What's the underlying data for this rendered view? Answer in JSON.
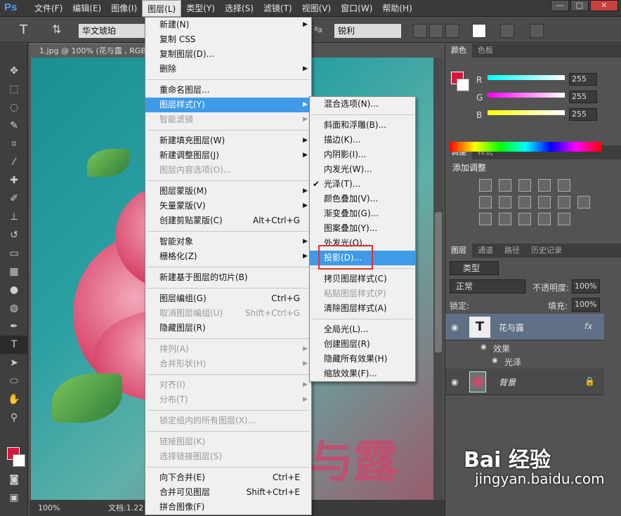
{
  "app": {
    "logo": "Ps",
    "logo_color": "#4ea0ff"
  },
  "menubar": [
    "文件(F)",
    "编辑(E)",
    "图像(I)",
    "图层(L)",
    "类型(Y)",
    "选择(S)",
    "滤镜(T)",
    "视图(V)",
    "窗口(W)",
    "帮助(H)"
  ],
  "options": {
    "font_family": "华文琥珀",
    "antialias": "锐利",
    "aa_icon": "ªa"
  },
  "document": {
    "tab_title": "1.jpg @ 100% (花与露 , RGB",
    "zoom": "100%",
    "doc_label": "文档:1.22"
  },
  "canvas_text": "与露",
  "layer_menu": [
    {
      "label": "新建(N)",
      "sub": true
    },
    {
      "label": "复制 CSS"
    },
    {
      "label": "复制图层(D)..."
    },
    {
      "label": "删除",
      "sub": true
    },
    {
      "sep": true
    },
    {
      "label": "重命名图层..."
    },
    {
      "label": "图层样式(Y)",
      "sub": true,
      "hi": true
    },
    {
      "label": "智能滤镜",
      "sub": true,
      "dis": true
    },
    {
      "sep": true
    },
    {
      "label": "新建填充图层(W)",
      "sub": true
    },
    {
      "label": "新建调整图层(J)",
      "sub": true
    },
    {
      "label": "图层内容选项(O)...",
      "dis": true
    },
    {
      "sep": true
    },
    {
      "label": "图层蒙版(M)",
      "sub": true
    },
    {
      "label": "矢量蒙版(V)",
      "sub": true
    },
    {
      "label": "创建剪贴蒙版(C)",
      "shortcut": "Alt+Ctrl+G"
    },
    {
      "sep": true
    },
    {
      "label": "智能对象",
      "sub": true
    },
    {
      "label": "栅格化(Z)",
      "sub": true
    },
    {
      "sep": true
    },
    {
      "label": "新建基于图层的切片(B)"
    },
    {
      "sep": true
    },
    {
      "label": "图层编组(G)",
      "shortcut": "Ctrl+G"
    },
    {
      "label": "取消图层编组(U)",
      "shortcut": "Shift+Ctrl+G",
      "dis": true
    },
    {
      "label": "隐藏图层(R)"
    },
    {
      "sep": true
    },
    {
      "label": "排列(A)",
      "sub": true,
      "dis": true
    },
    {
      "label": "合并形状(H)",
      "sub": true,
      "dis": true
    },
    {
      "sep": true
    },
    {
      "label": "对齐(I)",
      "sub": true,
      "dis": true
    },
    {
      "label": "分布(T)",
      "sub": true,
      "dis": true
    },
    {
      "sep": true
    },
    {
      "label": "锁定组内的所有图层(X)...",
      "dis": true
    },
    {
      "sep": true
    },
    {
      "label": "链接图层(K)",
      "dis": true
    },
    {
      "label": "选择链接图层(S)",
      "dis": true
    },
    {
      "sep": true
    },
    {
      "label": "向下合并(E)",
      "shortcut": "Ctrl+E"
    },
    {
      "label": "合并可见图层",
      "shortcut": "Shift+Ctrl+E"
    },
    {
      "label": "拼合图像(F)"
    }
  ],
  "style_submenu": [
    {
      "label": "混合选项(N)..."
    },
    {
      "sep": true
    },
    {
      "label": "斜面和浮雕(B)..."
    },
    {
      "label": "描边(K)..."
    },
    {
      "label": "内阴影(I)..."
    },
    {
      "label": "内发光(W)..."
    },
    {
      "label": "光泽(T)...",
      "checked": true
    },
    {
      "label": "颜色叠加(V)..."
    },
    {
      "label": "渐变叠加(G)..."
    },
    {
      "label": "图案叠加(Y)..."
    },
    {
      "label": "外发光(O)..."
    },
    {
      "label": "投影(D)...",
      "hi": true
    },
    {
      "sep": true
    },
    {
      "label": "拷贝图层样式(C)"
    },
    {
      "label": "粘贴图层样式(P)",
      "dis": true
    },
    {
      "label": "清除图层样式(A)"
    },
    {
      "sep": true
    },
    {
      "label": "全局光(L)..."
    },
    {
      "label": "创建图层(R)"
    },
    {
      "label": "隐藏所有效果(H)"
    },
    {
      "label": "缩放效果(F)..."
    }
  ],
  "color_panel": {
    "tabs": [
      "颜色",
      "色板"
    ],
    "channels": [
      {
        "name": "R",
        "value": "255",
        "grad": "linear-gradient(to right,#00ffff,#ffffff)"
      },
      {
        "name": "G",
        "value": "255",
        "grad": "linear-gradient(to right,#ff00ff,#ffffff)"
      },
      {
        "name": "B",
        "value": "255",
        "grad": "linear-gradient(to right,#ffff00,#ffffff)"
      }
    ],
    "fg_color": "#d6173c"
  },
  "adjust_panel": {
    "tabs": [
      "调整",
      "样式"
    ],
    "title": "添加调整"
  },
  "layers_panel": {
    "tabs": [
      "图层",
      "通道",
      "路径",
      "历史记录"
    ],
    "kind": "类型",
    "blend_mode": "正常",
    "opacity_label": "不透明度:",
    "opacity": "100%",
    "lock_label": "锁定:",
    "fill_label": "填充:",
    "fill": "100%",
    "layers": [
      {
        "name": "花与露",
        "effects_label": "效果",
        "effect": "光泽",
        "fx": "fx"
      },
      {
        "name": "背景"
      }
    ]
  },
  "watermark": {
    "brand": "Bai 经验",
    "url": "jingyan.baidu.com"
  }
}
